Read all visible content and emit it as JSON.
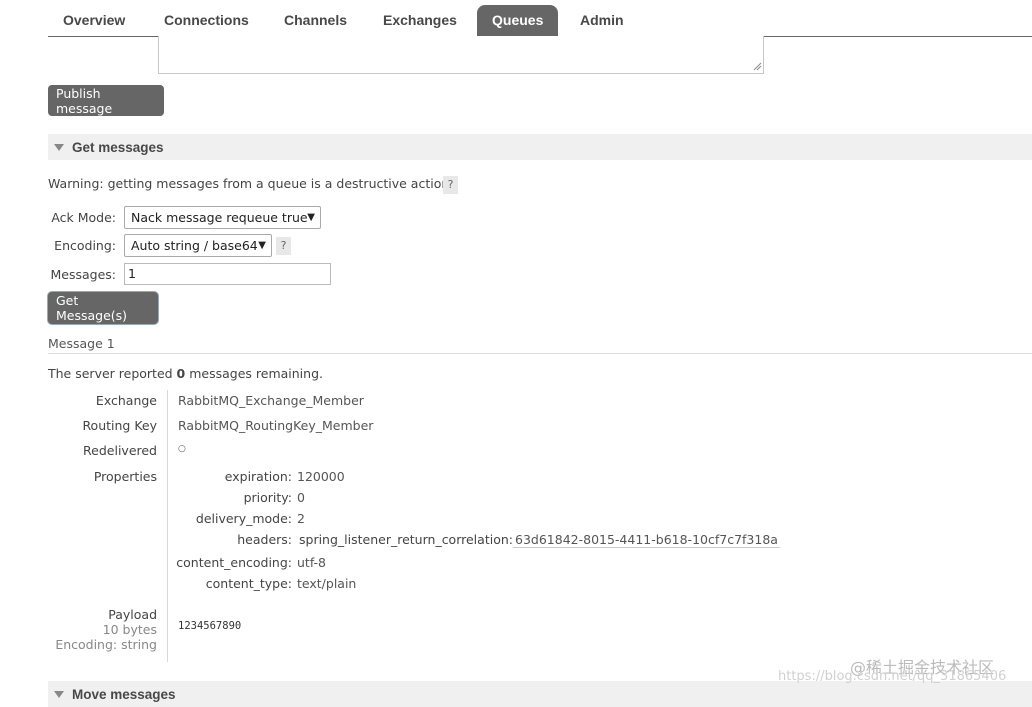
{
  "nav": {
    "tabs": [
      {
        "label": "Overview"
      },
      {
        "label": "Connections"
      },
      {
        "label": "Channels"
      },
      {
        "label": "Exchanges"
      },
      {
        "label": "Queues",
        "active": true
      },
      {
        "label": "Admin"
      }
    ]
  },
  "publish": {
    "button_label": "Publish message"
  },
  "get_messages": {
    "title": "Get messages",
    "warning": "Warning: getting messages from a queue is a destructive action.",
    "help": "?",
    "ack_mode_label": "Ack Mode:",
    "ack_mode_value": "Nack message requeue true",
    "encoding_label": "Encoding:",
    "encoding_value": "Auto string / base64",
    "messages_label": "Messages:",
    "messages_value": "1",
    "button_label": "Get Message(s)"
  },
  "message": {
    "heading": "Message 1",
    "server_prefix": "The server reported ",
    "remaining_count": "0",
    "server_suffix": " messages remaining.",
    "fields": {
      "exchange_label": "Exchange",
      "exchange_value": "RabbitMQ_Exchange_Member",
      "routing_key_label": "Routing Key",
      "routing_key_value": "RabbitMQ_RoutingKey_Member",
      "redelivered_label": "Redelivered",
      "redelivered_value": "○",
      "properties_label": "Properties",
      "payload_label": "Payload",
      "payload_size": "10 bytes",
      "payload_encoding": "Encoding: string",
      "payload_value": "1234567890"
    },
    "properties": {
      "expiration_label": "expiration:",
      "expiration_value": "120000",
      "priority_label": "priority:",
      "priority_value": "0",
      "delivery_mode_label": "delivery_mode:",
      "delivery_mode_value": "2",
      "headers_label": "headers:",
      "header_key": "spring_listener_return_correlation:",
      "header_value": "63d61842-8015-4411-b618-10cf7c7f318a",
      "content_encoding_label": "content_encoding:",
      "content_encoding_value": "utf-8",
      "content_type_label": "content_type:",
      "content_type_value": "text/plain"
    }
  },
  "move_messages": {
    "title": "Move messages"
  },
  "watermark": {
    "line1": "@稀土掘金技术社区",
    "line2": "https://blog.csdn.net/qq_31865406"
  }
}
